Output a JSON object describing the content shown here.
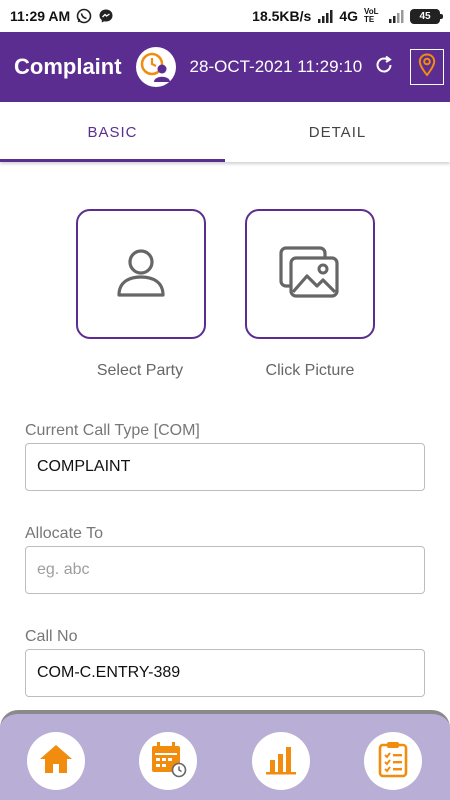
{
  "status_bar": {
    "time": "11:29 AM",
    "network_speed": "18.5KB/s",
    "network_type": "4G",
    "volte": "VoLTE",
    "battery": "45"
  },
  "app_bar": {
    "title": "Complaint",
    "datetime": "28-OCT-2021 11:29:10",
    "accent_color": "#5c2d91",
    "icons": [
      "clock-user-logo-icon",
      "refresh-icon",
      "location-pin-icon"
    ]
  },
  "tabs": [
    {
      "label": "BASIC",
      "active": true
    },
    {
      "label": "DETAIL",
      "active": false
    }
  ],
  "tiles": {
    "select_party": {
      "label": "Select Party",
      "icon": "person-icon"
    },
    "click_picture": {
      "label": "Click Picture",
      "icon": "image-gallery-icon"
    }
  },
  "form": {
    "call_type": {
      "label": "Current Call Type [COM]",
      "value": "COMPLAINT",
      "placeholder": ""
    },
    "allocate_to": {
      "label": "Allocate To",
      "value": "",
      "placeholder": "eg. abc"
    },
    "call_no": {
      "label": "Call No",
      "value": "COM-C.ENTRY-389",
      "placeholder": ""
    }
  },
  "bottom_nav": {
    "background": "#b8aed6",
    "icon_color": "#f28c0f",
    "items": [
      "home-icon",
      "calendar-clock-icon",
      "bar-chart-icon",
      "clipboard-checklist-icon"
    ]
  }
}
